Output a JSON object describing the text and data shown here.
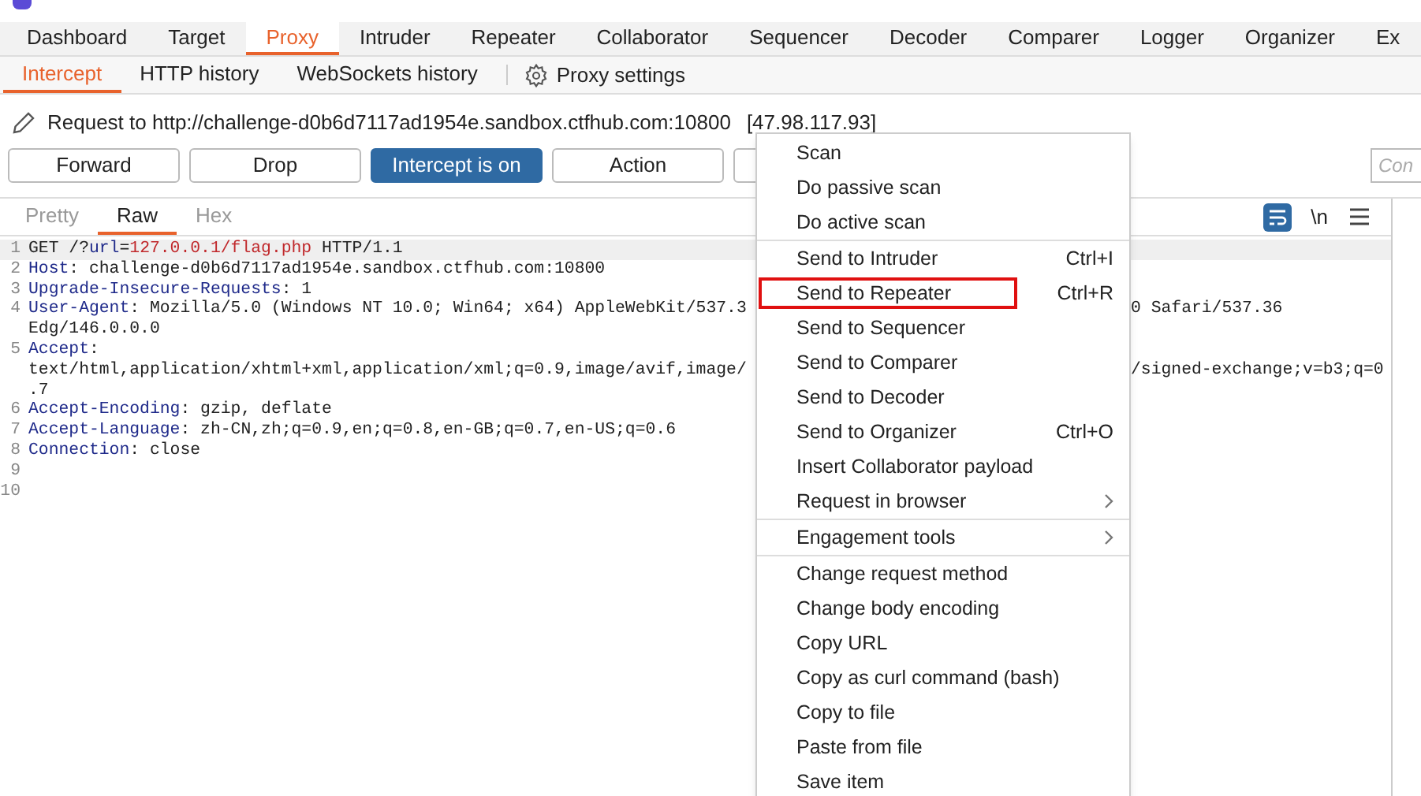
{
  "main_tabs": [
    {
      "label": "Dashboard",
      "selected": false
    },
    {
      "label": "Target",
      "selected": false
    },
    {
      "label": "Proxy",
      "selected": true
    },
    {
      "label": "Intruder",
      "selected": false
    },
    {
      "label": "Repeater",
      "selected": false
    },
    {
      "label": "Collaborator",
      "selected": false
    },
    {
      "label": "Sequencer",
      "selected": false
    },
    {
      "label": "Decoder",
      "selected": false
    },
    {
      "label": "Comparer",
      "selected": false
    },
    {
      "label": "Logger",
      "selected": false
    },
    {
      "label": "Organizer",
      "selected": false
    },
    {
      "label": "Ex",
      "selected": false
    }
  ],
  "sub_tabs": [
    {
      "label": "Intercept",
      "selected": true
    },
    {
      "label": "HTTP history",
      "selected": false
    },
    {
      "label": "WebSockets history",
      "selected": false
    }
  ],
  "proxy_settings": "Proxy settings",
  "request_line": {
    "label": "Request to http://challenge-d0b6d7117ad1954e.sandbox.ctfhub.com:10800",
    "ip": "[47.98.117.93]"
  },
  "buttons": [
    {
      "label": "Forward",
      "on": false
    },
    {
      "label": "Drop",
      "on": false
    },
    {
      "label": "Intercept is on",
      "on": true
    },
    {
      "label": "Action",
      "on": false
    }
  ],
  "comment_field": {
    "placeholder": "Con"
  },
  "editor_tabs": [
    {
      "label": "Pretty",
      "selected": false
    },
    {
      "label": "Raw",
      "selected": true
    },
    {
      "label": "Hex",
      "selected": false
    }
  ],
  "editor_tools": {
    "wrap_on": true,
    "newline": "\\n"
  },
  "lines": [
    {
      "num": "1",
      "rows": [
        {
          "segments": [
            {
              "kind": "plain",
              "text": "GET /?"
            },
            {
              "kind": "param",
              "text": "url"
            },
            {
              "kind": "plain",
              "text": "="
            },
            {
              "kind": "value",
              "text": "127.0.0.1/flag.php"
            },
            {
              "kind": "plain",
              "text": " HTTP/1.1"
            }
          ]
        }
      ]
    },
    {
      "num": "2",
      "rows": [
        {
          "segments": [
            {
              "kind": "key",
              "text": "Host"
            },
            {
              "kind": "plain",
              "text": ": challenge-d0b6d7117ad1954e.sandbox.ctfhub.com:10800"
            }
          ]
        }
      ]
    },
    {
      "num": "3",
      "rows": [
        {
          "segments": [
            {
              "kind": "key",
              "text": "Upgrade-Insecure-Requests"
            },
            {
              "kind": "plain",
              "text": ": 1"
            }
          ]
        }
      ]
    },
    {
      "num": "4",
      "rows": [
        {
          "segments": [
            {
              "kind": "key",
              "text": "User-Agent"
            },
            {
              "kind": "plain",
              "text": ": Mozilla/5.0 (Windows NT 10.0; Win64; x64) AppleWebKit/537.3"
            }
          ],
          "right": "0 Safari/537.36"
        },
        {
          "segments": [
            {
              "kind": "plain",
              "text": "Edg/146.0.0.0"
            }
          ]
        }
      ]
    },
    {
      "num": "5",
      "rows": [
        {
          "segments": [
            {
              "kind": "key",
              "text": "Accept"
            },
            {
              "kind": "plain",
              "text": ":"
            }
          ]
        },
        {
          "segments": [
            {
              "kind": "plain",
              "text": "text/html,application/xhtml+xml,application/xml;q=0.9,image/avif,image/"
            }
          ],
          "right": "/signed-exchange;v=b3;q=0"
        },
        {
          "segments": [
            {
              "kind": "plain",
              "text": ".7"
            }
          ]
        }
      ]
    },
    {
      "num": "6",
      "rows": [
        {
          "segments": [
            {
              "kind": "key",
              "text": "Accept-Encoding"
            },
            {
              "kind": "plain",
              "text": ": gzip, deflate"
            }
          ]
        }
      ]
    },
    {
      "num": "7",
      "rows": [
        {
          "segments": [
            {
              "kind": "key",
              "text": "Accept-Language"
            },
            {
              "kind": "plain",
              "text": ": zh-CN,zh;q=0.9,en;q=0.8,en-GB;q=0.7,en-US;q=0.6"
            }
          ]
        }
      ]
    },
    {
      "num": "8",
      "rows": [
        {
          "segments": [
            {
              "kind": "key",
              "text": "Connection"
            },
            {
              "kind": "plain",
              "text": ": close"
            }
          ]
        }
      ]
    },
    {
      "num": "9",
      "rows": [
        {
          "segments": []
        }
      ]
    },
    {
      "num": "10",
      "rows": [
        {
          "segments": []
        }
      ]
    }
  ],
  "context_menu": [
    {
      "label": "Scan",
      "highlighted": false
    },
    {
      "label": "Do passive scan",
      "highlighted": false
    },
    {
      "label": "Do active scan",
      "highlighted": false,
      "separator_after": true
    },
    {
      "label": "Send to Intruder",
      "shortcut": "Ctrl+I",
      "highlighted": false
    },
    {
      "label": "Send to Repeater",
      "shortcut": "Ctrl+R",
      "highlighted": true
    },
    {
      "label": "Send to Sequencer",
      "highlighted": false
    },
    {
      "label": "Send to Comparer",
      "highlighted": false
    },
    {
      "label": "Send to Decoder",
      "highlighted": false
    },
    {
      "label": "Send to Organizer",
      "shortcut": "Ctrl+O",
      "highlighted": false
    },
    {
      "label": "Insert Collaborator payload",
      "highlighted": false
    },
    {
      "label": "Request in browser",
      "submenu": true,
      "highlighted": false,
      "separator_after": true
    },
    {
      "label": "Engagement tools",
      "submenu": true,
      "highlighted": false,
      "separator_after": true
    },
    {
      "label": "Change request method",
      "highlighted": false
    },
    {
      "label": "Change body encoding",
      "highlighted": false
    },
    {
      "label": "Copy URL",
      "highlighted": false
    },
    {
      "label": "Copy as curl command (bash)",
      "highlighted": false
    },
    {
      "label": "Copy to file",
      "highlighted": false
    },
    {
      "label": "Paste from file",
      "highlighted": false
    },
    {
      "label": "Save item",
      "highlighted": false
    }
  ]
}
